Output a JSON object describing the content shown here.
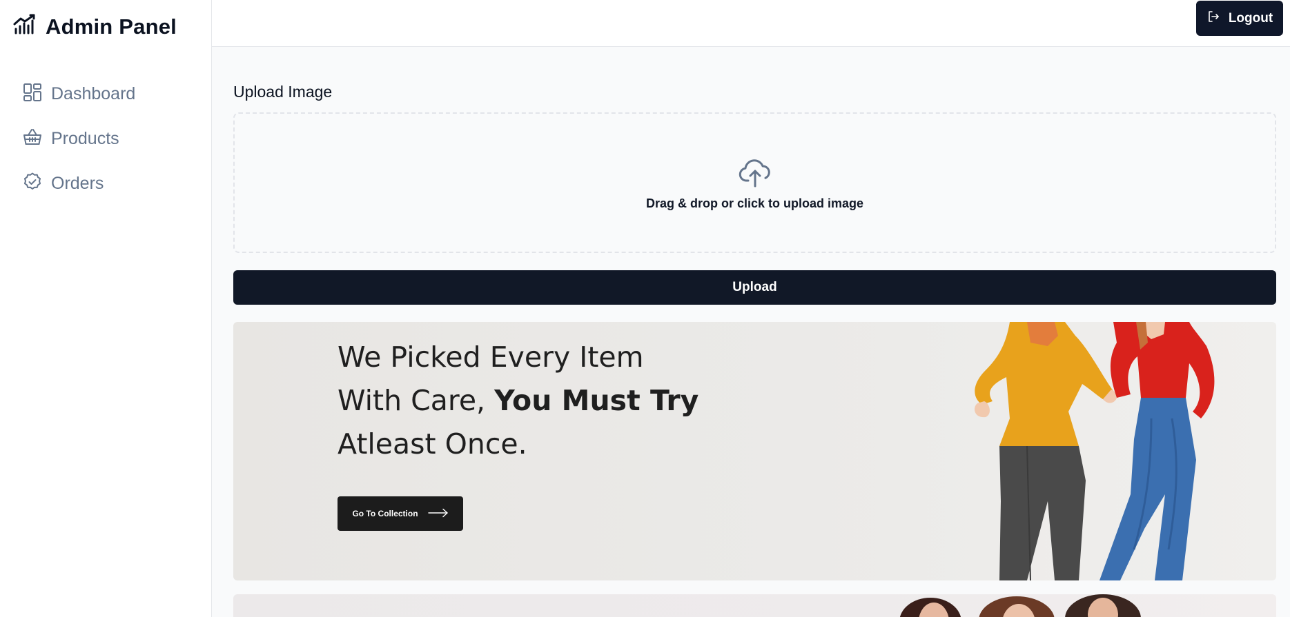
{
  "sidebar": {
    "brand_title": "Admin Panel",
    "brand_icon": "chart-line-icon",
    "items": [
      {
        "label": "Dashboard",
        "icon": "dashboard-icon"
      },
      {
        "label": "Products",
        "icon": "basket-icon"
      },
      {
        "label": "Orders",
        "icon": "badge-check-icon"
      }
    ]
  },
  "topbar": {
    "logout_label": "Logout",
    "logout_icon": "logout-icon"
  },
  "upload": {
    "title": "Upload Image",
    "dropzone_text": "Drag & drop or click to upload image",
    "dropzone_icon": "cloud-upload-icon",
    "button_label": "Upload"
  },
  "banner": {
    "line1": "We Picked Every Item",
    "line2_normal": "With Care, ",
    "line2_bold": "You Must Try",
    "line3": "Atleast Once.",
    "cta_label": "Go To Collection"
  },
  "colors": {
    "primary_dark": "#111827",
    "nav_text": "#64748b",
    "sweater_yellow": "#e8a21c",
    "sweater_red": "#d9221c",
    "jeans_gray": "#4a4a4a",
    "jeans_blue": "#3b6fb0"
  }
}
